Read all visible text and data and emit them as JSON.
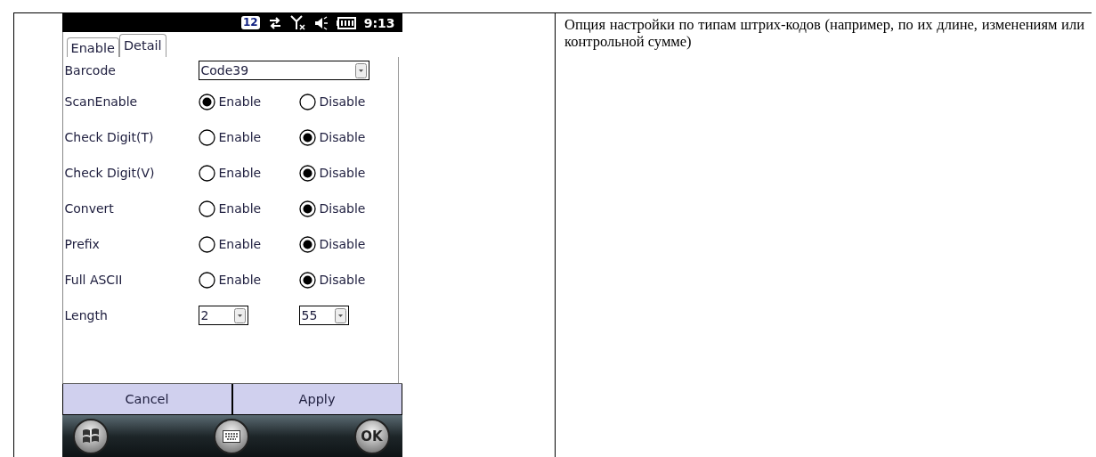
{
  "phone": {
    "status_bar": {
      "badge": "12",
      "time": "9:13"
    },
    "tabs": [
      {
        "label": "Enable",
        "selected": false
      },
      {
        "label": "Detail",
        "selected": true
      }
    ],
    "barcode": {
      "label": "Barcode",
      "value": "Code39"
    },
    "options": [
      {
        "label": "ScanEnable",
        "choices": [
          {
            "label": "Enable",
            "selected": true
          },
          {
            "label": "Disable",
            "selected": false
          }
        ]
      },
      {
        "label": "Check Digit(T)",
        "choices": [
          {
            "label": "Enable",
            "selected": false
          },
          {
            "label": "Disable",
            "selected": true
          }
        ]
      },
      {
        "label": "Check Digit(V)",
        "choices": [
          {
            "label": "Enable",
            "selected": false
          },
          {
            "label": "Disable",
            "selected": true
          }
        ]
      },
      {
        "label": "Convert",
        "choices": [
          {
            "label": "Enable",
            "selected": false
          },
          {
            "label": "Disable",
            "selected": true
          }
        ]
      },
      {
        "label": "Prefix",
        "choices": [
          {
            "label": "Enable",
            "selected": false
          },
          {
            "label": "Disable",
            "selected": true
          }
        ]
      },
      {
        "label": "Full ASCII",
        "choices": [
          {
            "label": "Enable",
            "selected": false
          },
          {
            "label": "Disable",
            "selected": true
          }
        ]
      }
    ],
    "length": {
      "label": "Length",
      "min": "2",
      "max": "55"
    },
    "buttons": [
      "Cancel",
      "Apply"
    ],
    "ok_key": "OK"
  },
  "description": "Опция настройки по типам штрих-кодов (например, по их длине, изменениям или контрольной сумме)"
}
